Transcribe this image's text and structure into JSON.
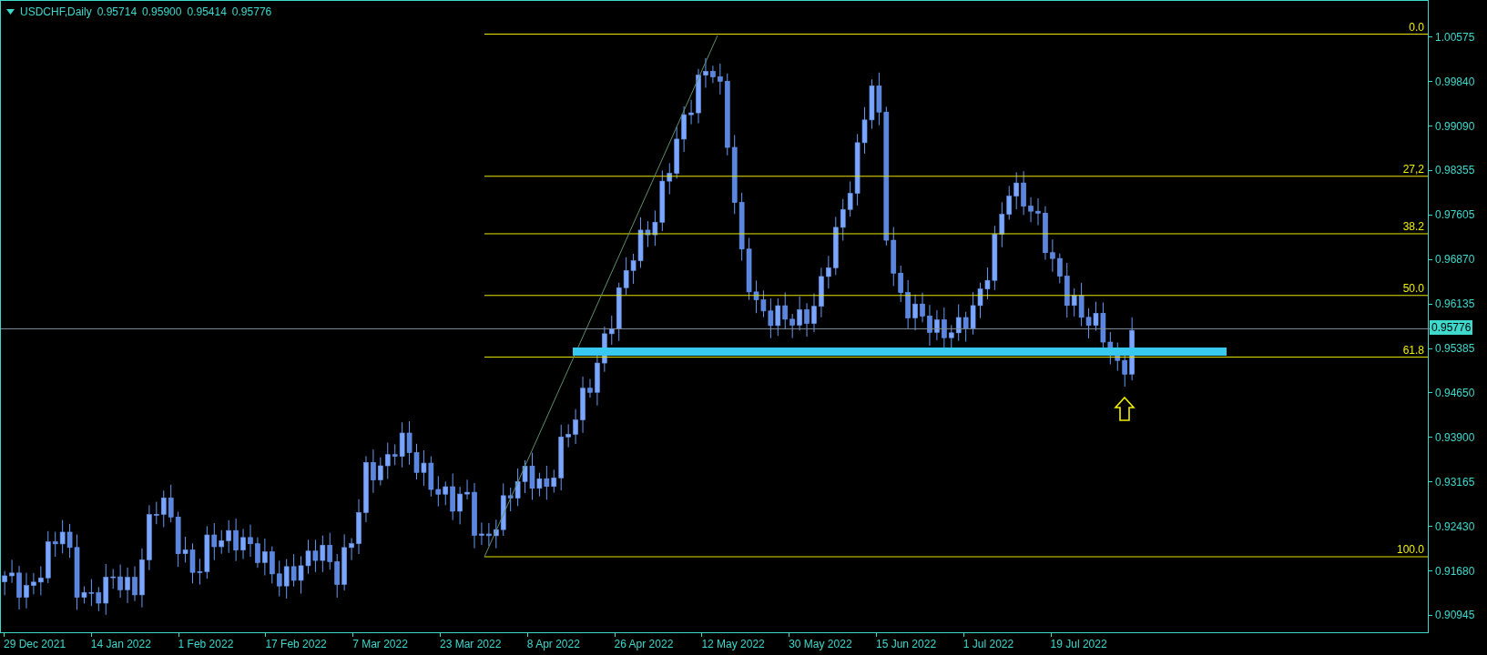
{
  "header": {
    "symbol": "USDCHF,Daily",
    "values": [
      "0.95714",
      "0.95900",
      "0.95414",
      "0.95776"
    ]
  },
  "price_axis": {
    "ticks": [
      "1.00575",
      "0.99840",
      "0.99090",
      "0.98355",
      "0.97605",
      "0.96870",
      "0.96135",
      "0.95385",
      "0.94650",
      "0.93900",
      "0.93165",
      "0.92430",
      "0.91680",
      "0.90945"
    ],
    "current_price": "0.95776"
  },
  "time_axis": {
    "labels": [
      "29 Dec 2021",
      "14 Jan 2022",
      "1 Feb 2022",
      "17 Feb 2022",
      "7 Mar 2022",
      "23 Mar 2022",
      "8 Apr 2022",
      "26 Apr 2022",
      "12 May 2022",
      "30 May 2022",
      "15 Jun 2022",
      "1 Jul 2022",
      "19 Jul 2022"
    ]
  },
  "fibonacci": {
    "levels": [
      "0.0",
      "27,2",
      "38.2",
      "50.0",
      "61.8",
      "100.0"
    ]
  }
}
